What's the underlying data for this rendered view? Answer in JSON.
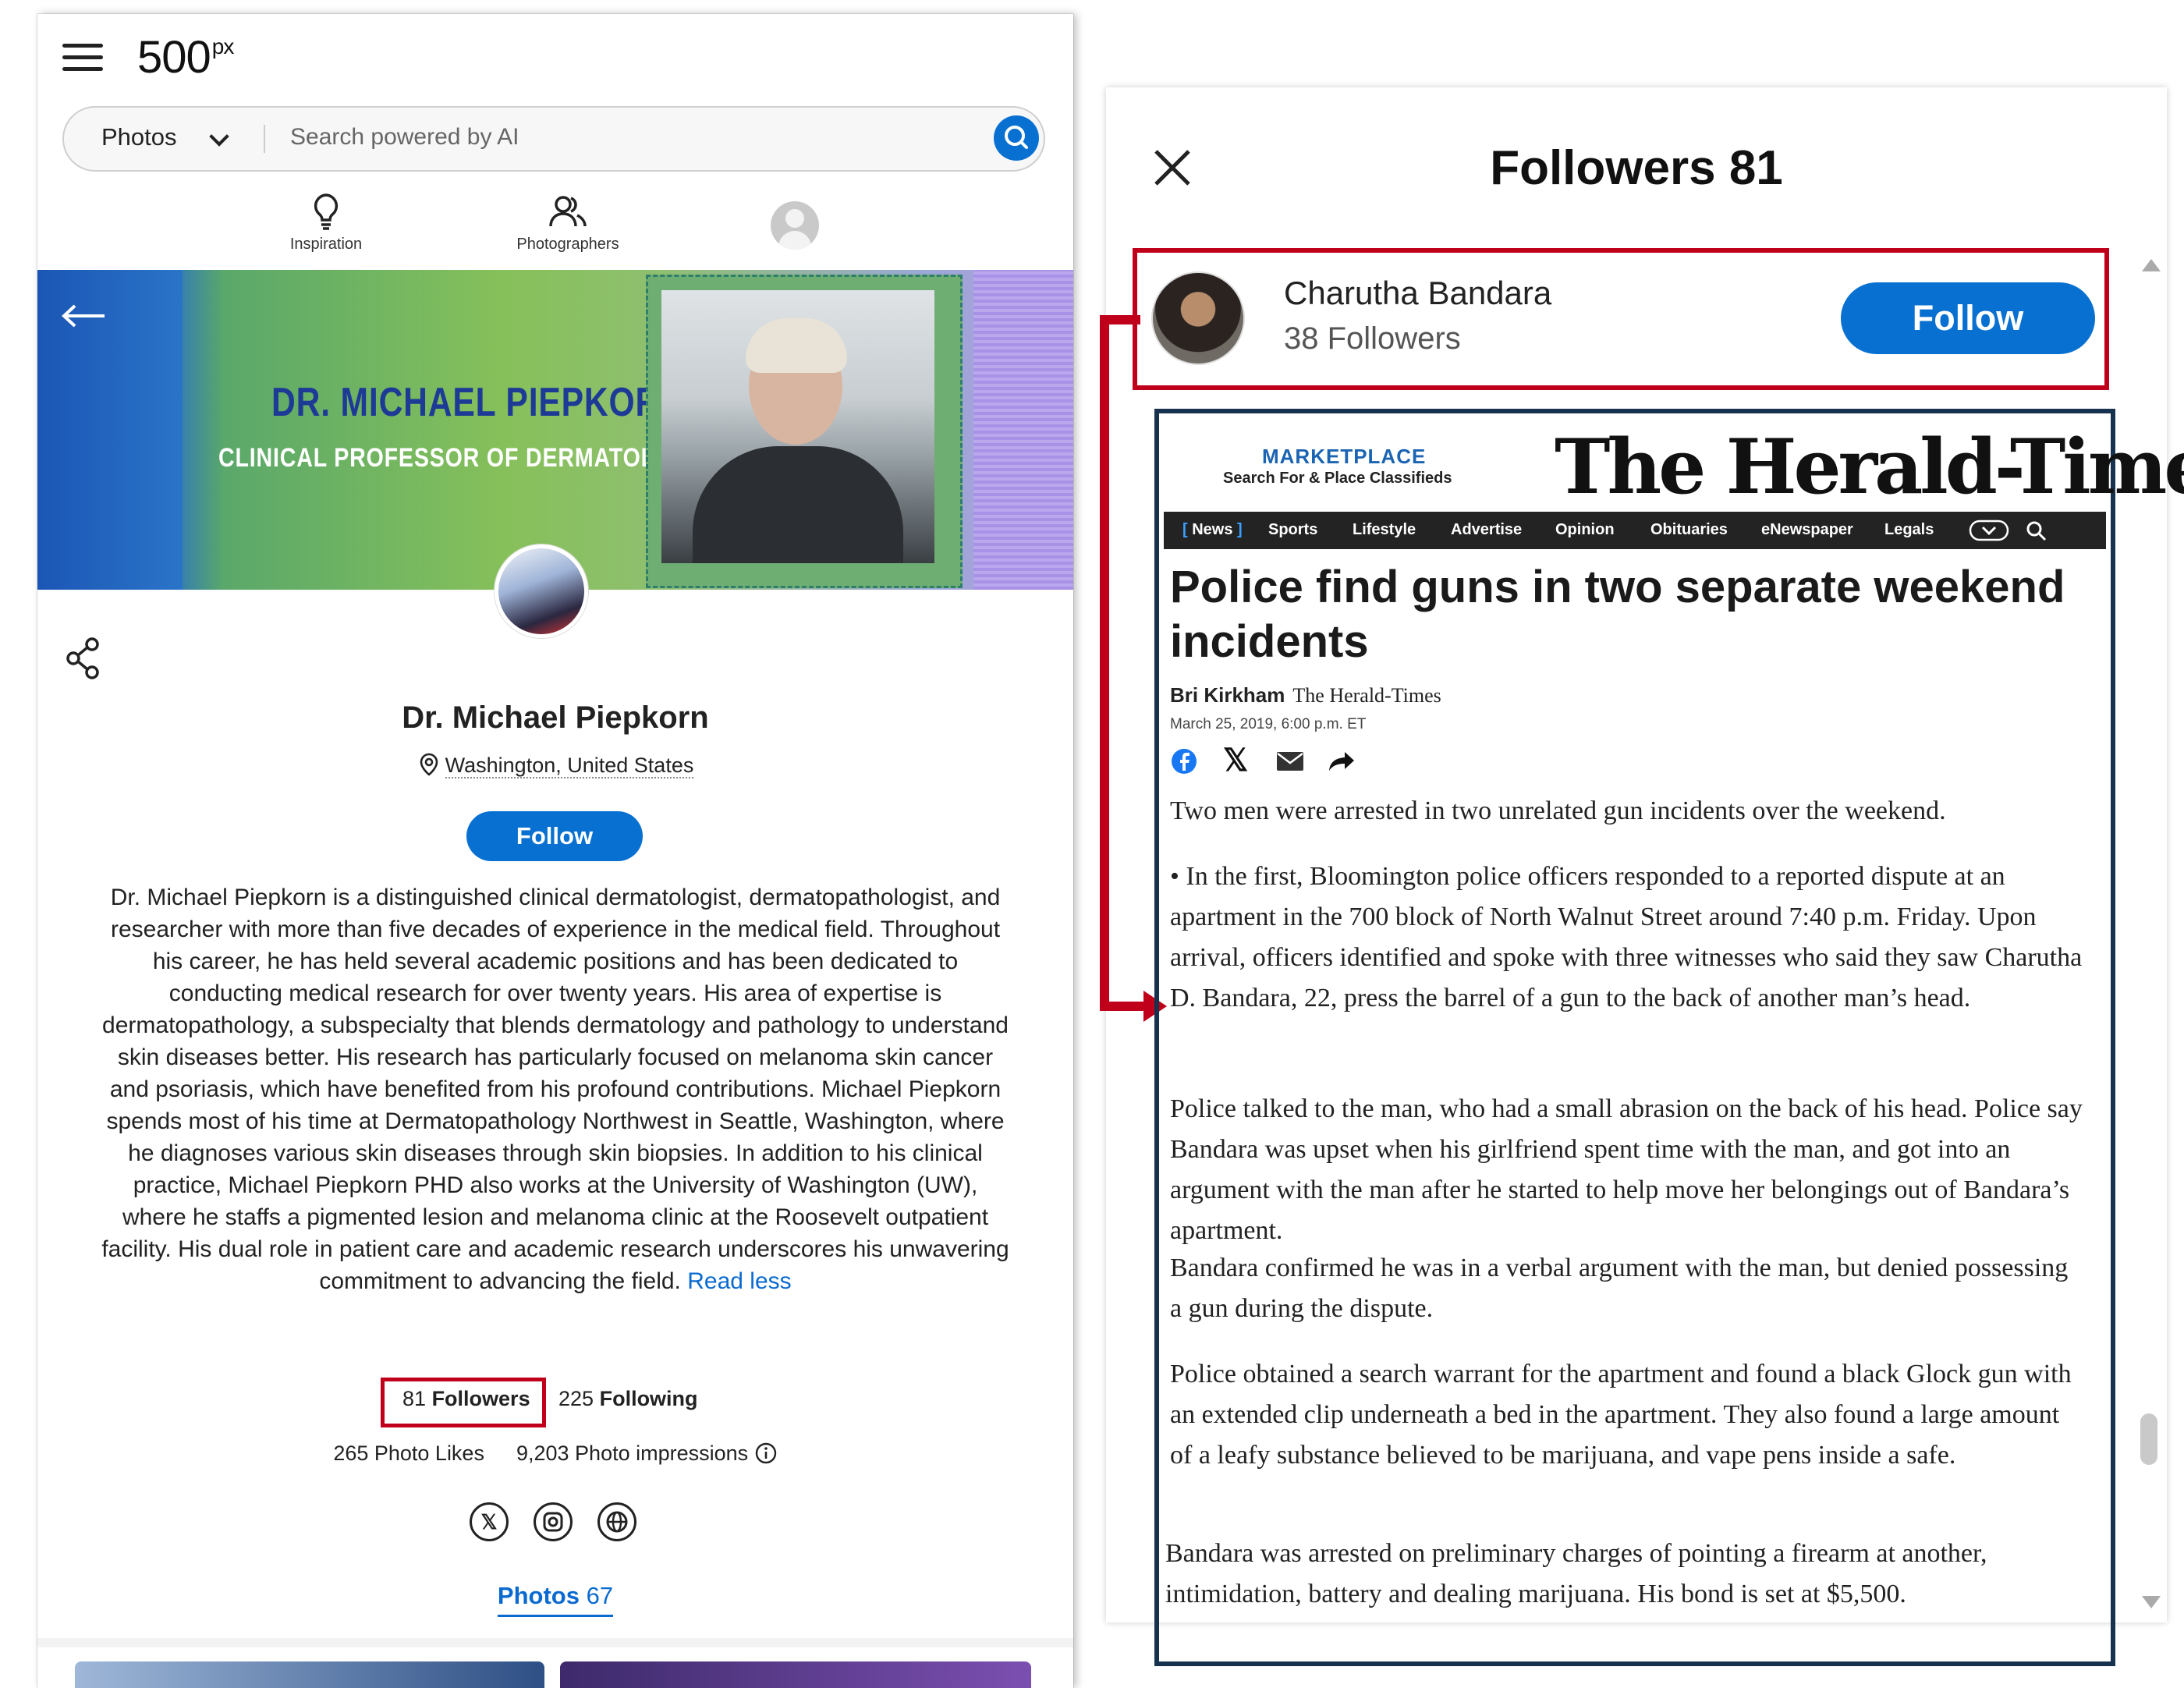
{
  "left": {
    "logo": "500",
    "logo_sup": "px",
    "search": {
      "category": "Photos",
      "placeholder": "Search powered by AI"
    },
    "nav": [
      {
        "label": "Inspiration",
        "icon": "lightbulb-icon"
      },
      {
        "label": "Photographers",
        "icon": "people-icon"
      }
    ],
    "banner": {
      "name": "DR. MICHAEL PIEPKORN",
      "subtitle": "CLINICAL PROFESSOR OF DERMATOLOGY"
    },
    "profile": {
      "name": "Dr. Michael Piepkorn",
      "location": "Washington, United States",
      "follow_label": "Follow",
      "bio": "Dr. Michael Piepkorn is a distinguished clinical dermatologist, dermatopathologist, and researcher with more than five decades of experience in the medical field. Throughout his career, he has held several academic positions and has been dedicated to conducting medical research for over twenty years. His area of expertise is dermatopathology, a subspecialty that blends dermatology and pathology to understand skin diseases better. His research has particularly focused on melanoma skin cancer and psoriasis, which have benefited from his profound contributions. Michael Piepkorn spends most of his time at Dermatopathology Northwest in Seattle, Washington, where he diagnoses various skin diseases through skin biopsies. In addition to his clinical practice, Michael Piepkorn PHD also works at the University of Washington (UW), where he staffs a pigmented lesion and melanoma clinic at the Roosevelt outpatient facility. His dual role in patient care and academic research underscores his unwavering commitment to advancing the field.",
      "read_less": "Read less",
      "followers_num": "81",
      "followers_label": "Followers",
      "following_num": "225",
      "following_label": "Following",
      "likes": "265 Photo Likes",
      "impressions": "9,203 Photo impressions",
      "photos_tab_label": "Photos",
      "photos_tab_count": "67"
    }
  },
  "right": {
    "title": "Followers 81",
    "follower": {
      "name": "Charutha Bandara",
      "count": "38 Followers",
      "follow_label": "Follow"
    },
    "article": {
      "marketplace": "MARKETPLACE",
      "marketplace_sub": "Search For & Place Classifieds",
      "masthead": "The Herald-Times",
      "nav": [
        "News",
        "Sports",
        "Lifestyle",
        "Advertise",
        "Opinion",
        "Obituaries",
        "eNewspaper",
        "Legals"
      ],
      "headline": "Police find guns in two separate weekend incidents",
      "author": "Bri Kirkham",
      "outlet": "The Herald-Times",
      "date": "March 25, 2019, 6:00 p.m. ET",
      "paragraphs": [
        "Two men were arrested in two unrelated gun incidents over the weekend.",
        "• In the first, Bloomington police officers responded to a reported dispute at an apartment in the 700 block of North Walnut Street around 7:40 p.m. Friday. Upon arrival, officers identified and spoke with three witnesses who said they saw Charutha D. Bandara, 22, press the barrel of a gun to the back of another man’s head.",
        "Police talked to the man, who had a small abrasion on the back of his head. Police say Bandara was upset when his girlfriend spent time with the man, and got into an argument with the man after he started to help move her belongings out of Bandara’s apartment.",
        "Bandara confirmed he was in a verbal argument with the man, but denied possessing a gun during the dispute.",
        "Police obtained a search warrant for the apartment and found a black Glock gun with an extended clip underneath a bed in the apartment. They also found a large amount of a leafy substance believed to be marijuana, and vape pens inside a safe.",
        "Bandara was arrested on preliminary charges of pointing a firearm at another, intimidation, battery and dealing marijuana. His bond is set at $5,500."
      ]
    }
  },
  "colors": {
    "accent": "#0870d1",
    "highlight": "#c0001a",
    "navy": "#17324f"
  }
}
